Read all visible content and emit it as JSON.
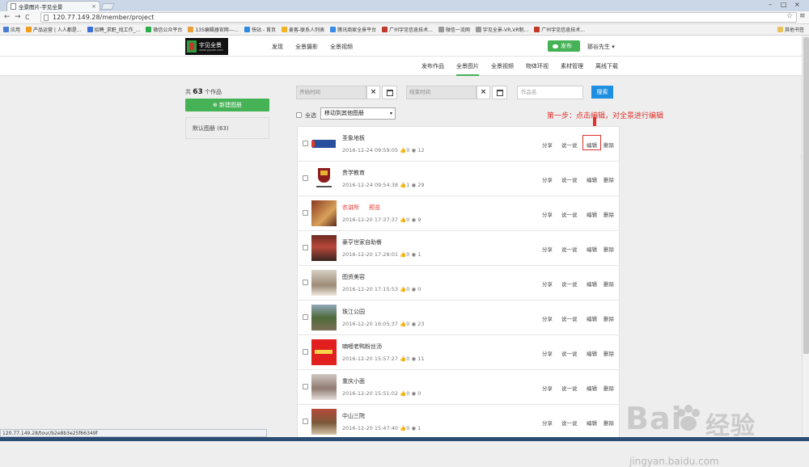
{
  "browser": {
    "tab_title": "全景图片-宇见全景",
    "tab_close": "×",
    "url": "120.77.149.28/member/project",
    "back": "←",
    "forward": "→",
    "reload": "C",
    "home": "⌂",
    "star": "☆",
    "menu": "≡",
    "win_min": "–",
    "win_max": "□",
    "win_close": "×",
    "status_url": "120.77.149.28/tour/b2e8b3e25f66349f"
  },
  "bookmarks": [
    {
      "label": "应用",
      "color": "#4a7bd3"
    },
    {
      "label": "产品运营 | 人人都是...",
      "color": "#f29b1c"
    },
    {
      "label": "招聘_求职_找工作_...",
      "color": "#3a6fd8"
    },
    {
      "label": "微信公众平台",
      "color": "#2bae4b"
    },
    {
      "label": "135编辑器官网---...",
      "color": "#e8a037"
    },
    {
      "label": "快站 - 首页",
      "color": "#2c8be0"
    },
    {
      "label": "麦客-联系人列表",
      "color": "#f3b325"
    },
    {
      "label": "腾讯商家全景平台",
      "color": "#3b8ce8"
    },
    {
      "label": "广州宇见信息技术...",
      "color": "#c0392b"
    },
    {
      "label": "微信一流网",
      "color": "#999999"
    },
    {
      "label": "宇见全景-VR,VR制...",
      "color": "#999999"
    },
    {
      "label": "广州宇见信息技术...",
      "color": "#c0392b"
    }
  ],
  "bookmarks_other": "其他书签",
  "site": {
    "logo_text": "宇见全景",
    "logo_sub": "www.yjquan.com",
    "nav": [
      "发现",
      "全景摄影",
      "全景视频"
    ],
    "publish": "发布",
    "user": "那谷先生 ▾",
    "subnav": [
      "发布作品",
      "全景图片",
      "全景视频",
      "物体环视",
      "素材管理",
      "离线下载"
    ],
    "subnav_active": "全景图片"
  },
  "left": {
    "count_prefix": "共",
    "count": "63",
    "count_suffix": "个作品",
    "new_album": "新建图册",
    "default_album": "默认图册 (63)"
  },
  "filters": {
    "start_placeholder": "开始时间",
    "end_placeholder": "结束时间",
    "clear": "×",
    "name_placeholder": "作品名",
    "search": "搜索",
    "select_all": "全选",
    "move_to": "移动到其他图册",
    "move_arrow": "▾"
  },
  "annotation": "第一步：点击编辑，对全景进行编辑",
  "actions": {
    "share": "分享",
    "say": "说一说",
    "edit": "编辑",
    "delete": "删除"
  },
  "works": [
    {
      "title": "圣象地板",
      "date": "2016-12-24 09:59:05",
      "likes": "0",
      "views": "12",
      "thumb": "logo-sx",
      "red": false,
      "tag": ""
    },
    {
      "title": "贵学教育",
      "date": "2016-12-24 09:54:38",
      "likes": "1",
      "views": "29",
      "thumb": "logo-gx",
      "red": false,
      "tag": ""
    },
    {
      "title": "农讲所",
      "date": "2016-12-20 17:37:37",
      "likes": "0",
      "views": "9",
      "thumb": "photo-a",
      "red": true,
      "tag": "预览"
    },
    {
      "title": "豪亨世家自助餐",
      "date": "2016-12-20 17:28:01",
      "likes": "0",
      "views": "1",
      "thumb": "photo-b",
      "red": false,
      "tag": ""
    },
    {
      "title": "图资美容",
      "date": "2016-12-20 17:15:53",
      "likes": "0",
      "views": "0",
      "thumb": "photo-c",
      "red": false,
      "tag": ""
    },
    {
      "title": "珠江公园",
      "date": "2016-12-20 16:05:37",
      "likes": "0",
      "views": "23",
      "thumb": "photo-d",
      "red": false,
      "tag": ""
    },
    {
      "title": "喃喱老鸭粉丝汤",
      "date": "2016-12-20 15:57:27",
      "likes": "0",
      "views": "11",
      "thumb": "logo-red",
      "red": false,
      "tag": ""
    },
    {
      "title": "重庆小面",
      "date": "2016-12-20 15:51:02",
      "likes": "0",
      "views": "0",
      "thumb": "photo-e",
      "red": false,
      "tag": ""
    },
    {
      "title": "中山三院",
      "date": "2016-12-20 15:47:40",
      "likes": "0",
      "views": "1",
      "thumb": "photo-f",
      "red": false,
      "tag": ""
    }
  ],
  "watermark": {
    "main": "Bai",
    "paw": "经验",
    "sub": "jingyan.baidu.com"
  }
}
